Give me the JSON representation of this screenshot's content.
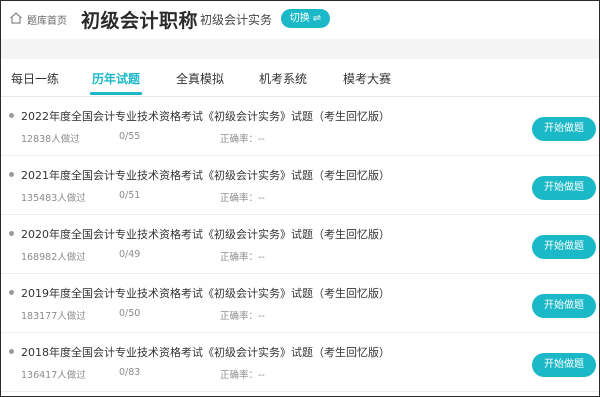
{
  "header": {
    "home_label": "题库首页",
    "title": "初级会计职称",
    "subtitle": "初级会计实务",
    "switch_label": "切换",
    "switch_icon": "⇌"
  },
  "tabs": [
    {
      "label": "每日一练",
      "active": false
    },
    {
      "label": "历年试题",
      "active": true
    },
    {
      "label": "全真模拟",
      "active": false
    },
    {
      "label": "机考系统",
      "active": false
    },
    {
      "label": "模考大赛",
      "active": false
    }
  ],
  "papers": [
    {
      "title": "2022年度全国会计专业技术资格考试《初级会计实务》试题（考生回忆版）",
      "count": "12838人做过",
      "progress": "0/55",
      "accuracy": "正确率：--",
      "button": "开始做题"
    },
    {
      "title": "2021年度全国会计专业技术资格考试《初级会计实务》试题（考生回忆版）",
      "count": "135483人做过",
      "progress": "0/51",
      "accuracy": "正确率：--",
      "button": "开始做题"
    },
    {
      "title": "2020年度全国会计专业技术资格考试《初级会计实务》试题（考生回忆版）",
      "count": "168982人做过",
      "progress": "0/49",
      "accuracy": "正确率：--",
      "button": "开始做题"
    },
    {
      "title": "2019年度全国会计专业技术资格考试《初级会计实务》试题（考生回忆版）",
      "count": "183177人做过",
      "progress": "0/50",
      "accuracy": "正确率：--",
      "button": "开始做题"
    },
    {
      "title": "2018年度全国会计专业技术资格考试《初级会计实务》试题（考生回忆版）",
      "count": "136417人做过",
      "progress": "0/83",
      "accuracy": "正确率：--",
      "button": "开始做题"
    }
  ],
  "colors": {
    "accent": "#1bb9c8",
    "muted": "#8c8c8c"
  }
}
